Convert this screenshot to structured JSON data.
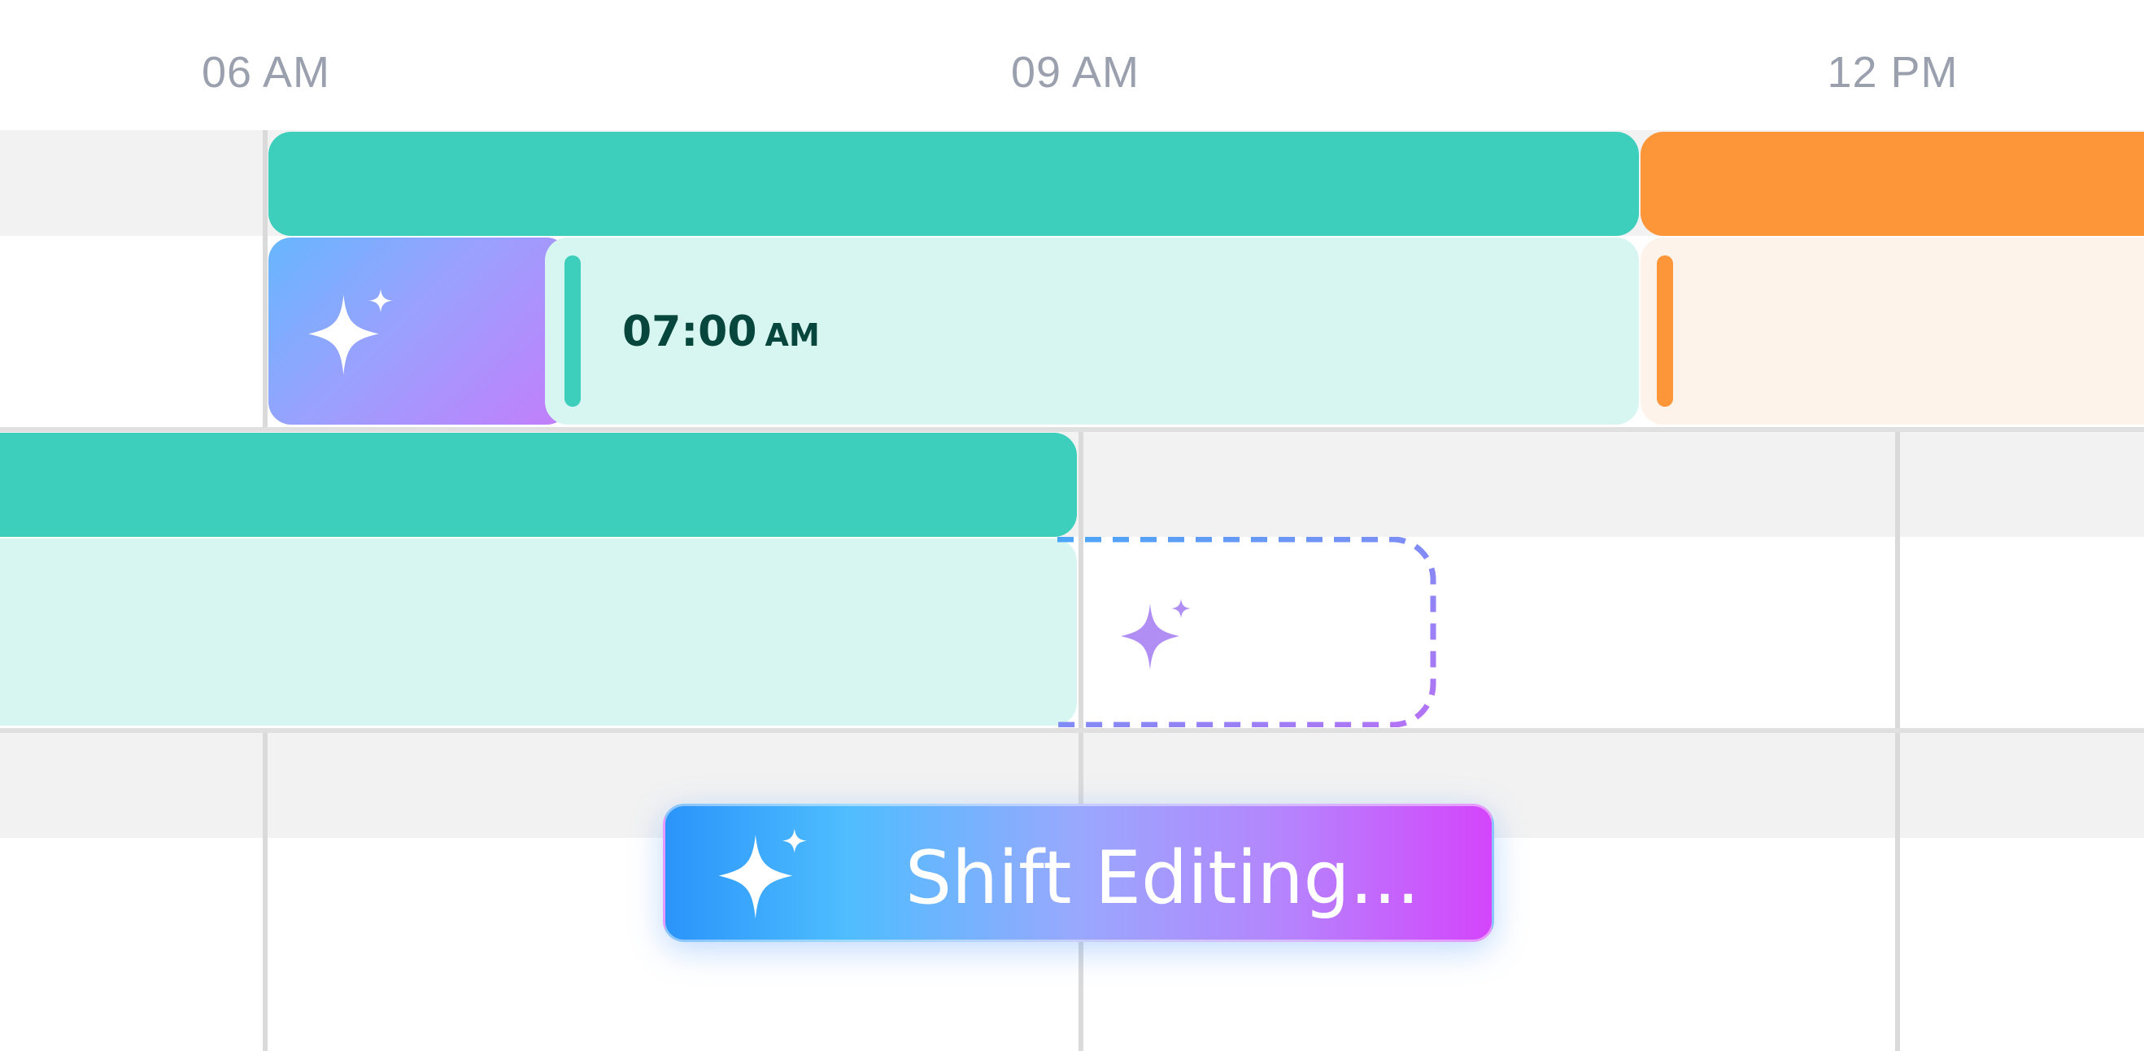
{
  "timeline": {
    "hour_labels": [
      "06 AM",
      "09 AM",
      "12 PM"
    ]
  },
  "shift": {
    "start_time": "07:00",
    "start_ampm": "AM"
  },
  "banner": {
    "label": "Shift Editing..."
  },
  "icons": {
    "ai_sparkle": "sparkle-icon"
  },
  "colors": {
    "teal": "#3ecfbc",
    "teal_light": "#d8f6f1",
    "orange": "#fd9539",
    "peach": "#fdf3eb",
    "ai_gradient_start": "#2a94fa",
    "ai_gradient_end": "#d445fb"
  }
}
